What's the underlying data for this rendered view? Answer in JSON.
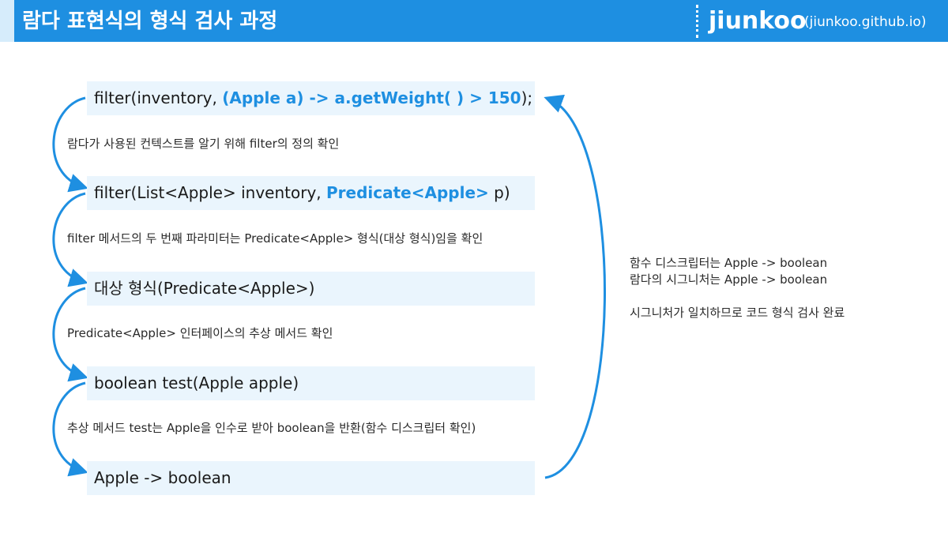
{
  "header": {
    "title": "람다 표현식의 형식 검사 과정",
    "brand_name": "jiunkoo",
    "brand_url": "(jiunkoo.github.io)"
  },
  "steps": [
    {
      "text_before": "filter(inventory, ",
      "highlight": "(Apple a) -> a.getWeight( ) > 150",
      "text_after": ");"
    },
    {
      "text_before": "filter(List<Apple> inventory, ",
      "highlight": "Predicate<Apple>",
      "text_after": " p)"
    },
    {
      "text_before": "대상 형식(Predicate<Apple>)",
      "highlight": "",
      "text_after": ""
    },
    {
      "text_before": "boolean test(Apple apple)",
      "highlight": "",
      "text_after": ""
    },
    {
      "text_before": "Apple -> boolean",
      "highlight": "",
      "text_after": ""
    }
  ],
  "notes": [
    "람다가 사용된 컨텍스트를 알기 위해 filter의 정의 확인",
    "filter 메서드의 두 번째 파라미터는 Predicate<Apple> 형식(대상 형식)임을 확인",
    "Predicate<Apple> 인터페이스의 추상 메서드 확인",
    "추상 메서드 test는 Apple을 인수로 받아 boolean을 반환(함수 디스크립터 확인)"
  ],
  "side_notes": {
    "line1": "함수 디스크립터는 Apple -> boolean",
    "line2": "람다의 시그니처는 Apple -> boolean",
    "line3": "시그니처가 일치하므로 코드 형식 검사 완료"
  },
  "colors": {
    "accent": "#1e8fe1",
    "box_bg": "#eaf5fd",
    "header_accent": "#d6ecfb"
  }
}
